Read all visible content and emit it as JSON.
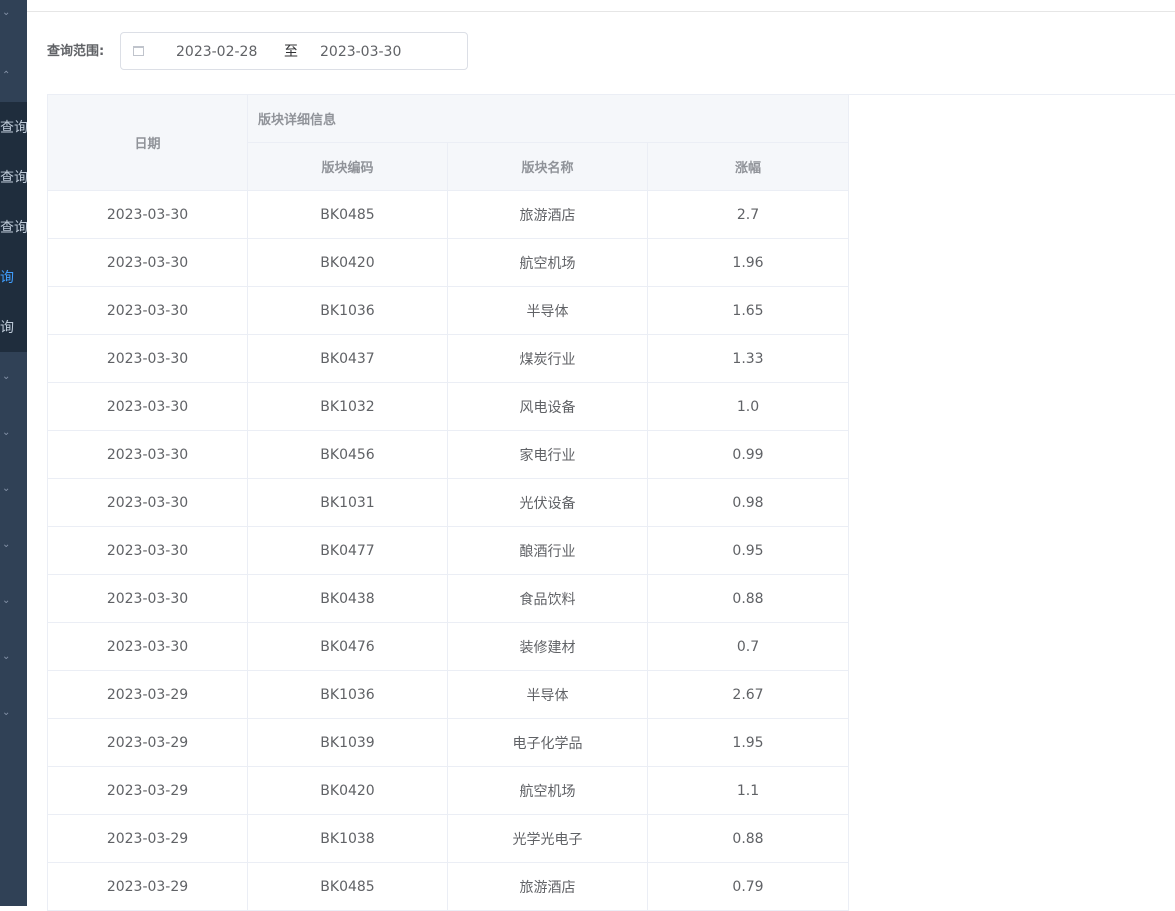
{
  "sidebar": {
    "items": [
      {
        "label": "查询",
        "active": false
      },
      {
        "label": "查询",
        "active": false
      },
      {
        "label": "查询",
        "active": false
      },
      {
        "label": "询",
        "active": true
      },
      {
        "label": "询",
        "active": false
      }
    ]
  },
  "form": {
    "label": "查询范围:",
    "start_date": "2023-02-28",
    "separator": "至",
    "end_date": "2023-03-30"
  },
  "table": {
    "headers": {
      "date": "日期",
      "group": "版块详细信息",
      "code": "版块编码",
      "name": "版块名称",
      "change": "涨幅"
    },
    "rows": [
      {
        "date": "2023-03-30",
        "code": "BK0485",
        "name": "旅游酒店",
        "change": "2.7"
      },
      {
        "date": "2023-03-30",
        "code": "BK0420",
        "name": "航空机场",
        "change": "1.96"
      },
      {
        "date": "2023-03-30",
        "code": "BK1036",
        "name": "半导体",
        "change": "1.65"
      },
      {
        "date": "2023-03-30",
        "code": "BK0437",
        "name": "煤炭行业",
        "change": "1.33"
      },
      {
        "date": "2023-03-30",
        "code": "BK1032",
        "name": "风电设备",
        "change": "1.0"
      },
      {
        "date": "2023-03-30",
        "code": "BK0456",
        "name": "家电行业",
        "change": "0.99"
      },
      {
        "date": "2023-03-30",
        "code": "BK1031",
        "name": "光伏设备",
        "change": "0.98"
      },
      {
        "date": "2023-03-30",
        "code": "BK0477",
        "name": "酿酒行业",
        "change": "0.95"
      },
      {
        "date": "2023-03-30",
        "code": "BK0438",
        "name": "食品饮料",
        "change": "0.88"
      },
      {
        "date": "2023-03-30",
        "code": "BK0476",
        "name": "装修建材",
        "change": "0.7"
      },
      {
        "date": "2023-03-29",
        "code": "BK1036",
        "name": "半导体",
        "change": "2.67"
      },
      {
        "date": "2023-03-29",
        "code": "BK1039",
        "name": "电子化学品",
        "change": "1.95"
      },
      {
        "date": "2023-03-29",
        "code": "BK0420",
        "name": "航空机场",
        "change": "1.1"
      },
      {
        "date": "2023-03-29",
        "code": "BK1038",
        "name": "光学光电子",
        "change": "0.88"
      },
      {
        "date": "2023-03-29",
        "code": "BK0485",
        "name": "旅游酒店",
        "change": "0.79"
      }
    ]
  }
}
